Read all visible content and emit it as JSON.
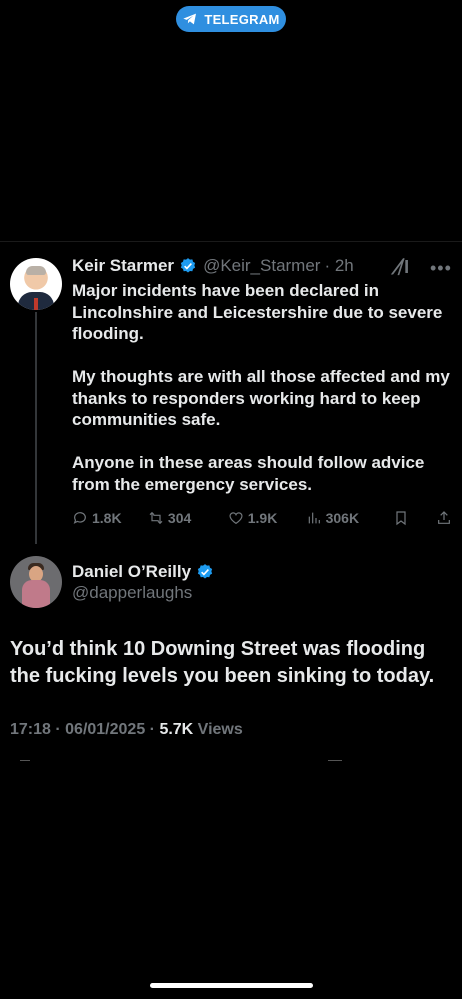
{
  "top_pill": {
    "label": "TELEGRAM",
    "icon": "telegram-icon",
    "color": "#2f8fe0"
  },
  "quoted_tweet": {
    "author_name": "Keir Starmer",
    "handle": "@Keir_Starmer",
    "time": "· 2h",
    "paragraphs": [
      "Major incidents have been declared in Lincolnshire and Leicestershire due to severe flooding.",
      "My thoughts are with all those affected and my thanks to responders working hard to keep communities safe.",
      "Anyone in these areas should follow advice from the emergency services."
    ],
    "replies": "1.8K",
    "reposts": "304",
    "likes": "1.9K",
    "views": "306K"
  },
  "reply_tweet": {
    "author_name": "Daniel O’Reilly",
    "handle": "@dapperlaughs",
    "text": "You’d think 10 Downing Street was flooding the fucking levels you been sinking to today.",
    "timestamp": "17:18 · 06/01/2025 · ",
    "views_count": "5.7K",
    "views_label": " Views"
  },
  "colors": {
    "verified": "#1d9bf0",
    "muted": "#71767b",
    "text": "#e7e9ea",
    "background": "#000000"
  }
}
